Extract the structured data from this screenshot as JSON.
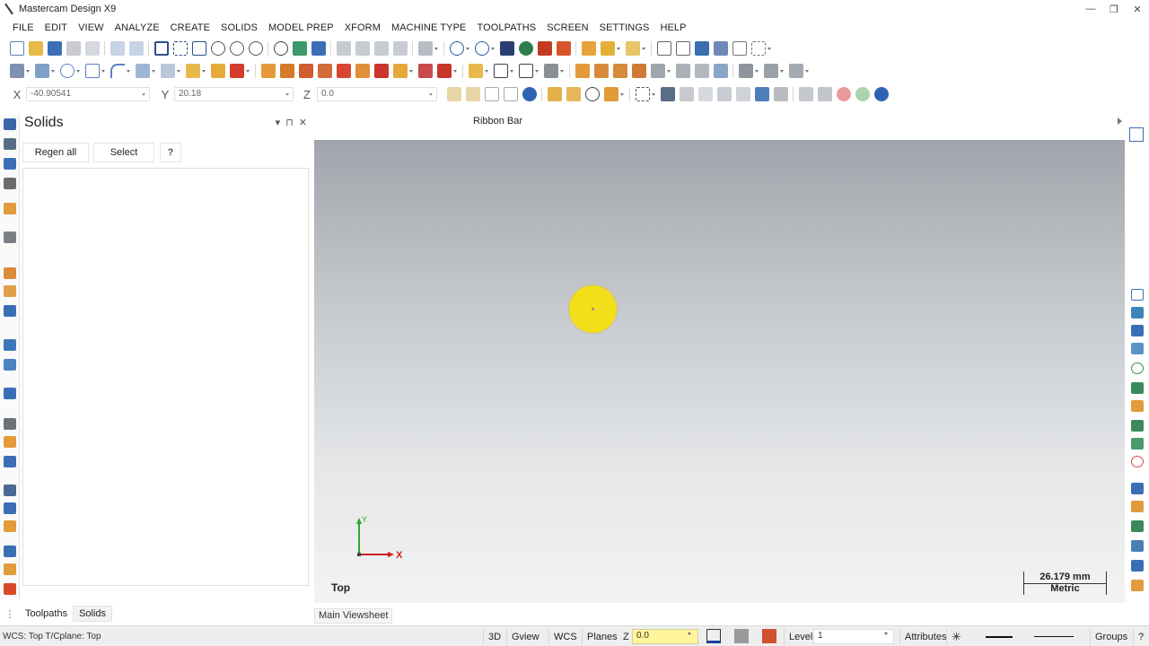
{
  "window": {
    "title": "Mastercam Design X9",
    "minimize": "—",
    "maximize": "❐",
    "close": "✕"
  },
  "menu": [
    {
      "label": "FILE"
    },
    {
      "label": "EDIT"
    },
    {
      "label": "VIEW"
    },
    {
      "label": "ANALYZE"
    },
    {
      "label": "CREATE"
    },
    {
      "label": "SOLIDS"
    },
    {
      "label": "MODEL PREP"
    },
    {
      "label": "XFORM"
    },
    {
      "label": "MACHINE TYPE"
    },
    {
      "label": "TOOLPATHS"
    },
    {
      "label": "SCREEN"
    },
    {
      "label": "SETTINGS"
    },
    {
      "label": "HELP"
    }
  ],
  "coordinates": {
    "x_label": "X",
    "x_value": "-40.90541",
    "y_label": "Y",
    "y_value": "20.18",
    "z_label": "Z",
    "z_value": "0.0"
  },
  "ribbon": {
    "label": "Ribbon Bar"
  },
  "panel": {
    "title": "Solids",
    "pin_icon": "⊓",
    "close_icon": "✕",
    "regen_label": "Regen all",
    "select_label": "Select",
    "help_label": "?"
  },
  "bottom_tabs": [
    {
      "label": "Toolpaths"
    },
    {
      "label": "Solids"
    }
  ],
  "viewport": {
    "view_name": "Top",
    "axis_x": "X",
    "axis_y": "Y",
    "scale_value": "26.179 mm",
    "scale_unit": "Metric",
    "viewsheet_tab": "Main Viewsheet"
  },
  "status": {
    "text": "WCS: Top  T/Cplane: Top",
    "btn_3d": "3D",
    "gview": "Gview",
    "wcs": "WCS",
    "planes": "Planes",
    "z_label": "Z",
    "z_value": "0.0",
    "level_label": "Level",
    "level_value": "1",
    "attributes": "Attributes",
    "groups": "Groups",
    "help": "?"
  },
  "colors": {
    "accent_blue": "#1f5fa8",
    "cursor_yellow": "#f3de1a",
    "axis_red": "#d21e1e",
    "axis_green": "#2fa82f"
  }
}
